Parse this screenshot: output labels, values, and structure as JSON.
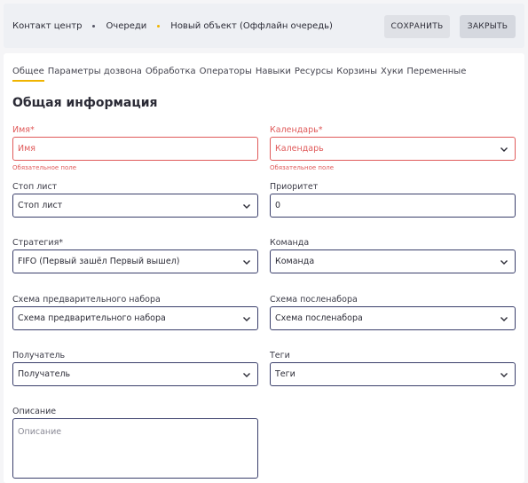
{
  "header": {
    "breadcrumb": [
      "Контакт центр",
      "Очереди",
      "Новый объект (Оффлайн очередь)"
    ],
    "save_label": "СОХРАНИТЬ",
    "close_label": "ЗАКРЫТЬ"
  },
  "tabs": [
    "Общее",
    "Параметры дозвона",
    "Обработка",
    "Операторы",
    "Навыки",
    "Ресурсы",
    "Корзины",
    "Хуки",
    "Переменные"
  ],
  "section_title": "Общая информация",
  "fields": {
    "name": {
      "label": "Имя*",
      "placeholder": "Имя",
      "hint": "Обязательное поле"
    },
    "calendar": {
      "label": "Календарь*",
      "placeholder": "Календарь",
      "hint": "Обязательное поле"
    },
    "stoplist": {
      "label": "Стоп лист",
      "value": "Стоп лист"
    },
    "priority": {
      "label": "Приоритет",
      "value": "0"
    },
    "strategy": {
      "label": "Стратегия*",
      "value": "FIFO (Первый зашёл Первый вышел)"
    },
    "team": {
      "label": "Команда",
      "value": "Команда"
    },
    "predial": {
      "label": "Схема предварительного набора",
      "value": "Схема предварительного набора"
    },
    "postdial": {
      "label": "Схема посленабора",
      "value": "Схема посленабора"
    },
    "recipient": {
      "label": "Получатель",
      "value": "Получатель"
    },
    "tags": {
      "label": "Теги",
      "value": "Теги"
    },
    "description": {
      "label": "Описание",
      "placeholder": "Описание"
    }
  },
  "colors": {
    "accent": "#f0b400",
    "error": "#e05a5a",
    "border": "#3a3f6b"
  }
}
